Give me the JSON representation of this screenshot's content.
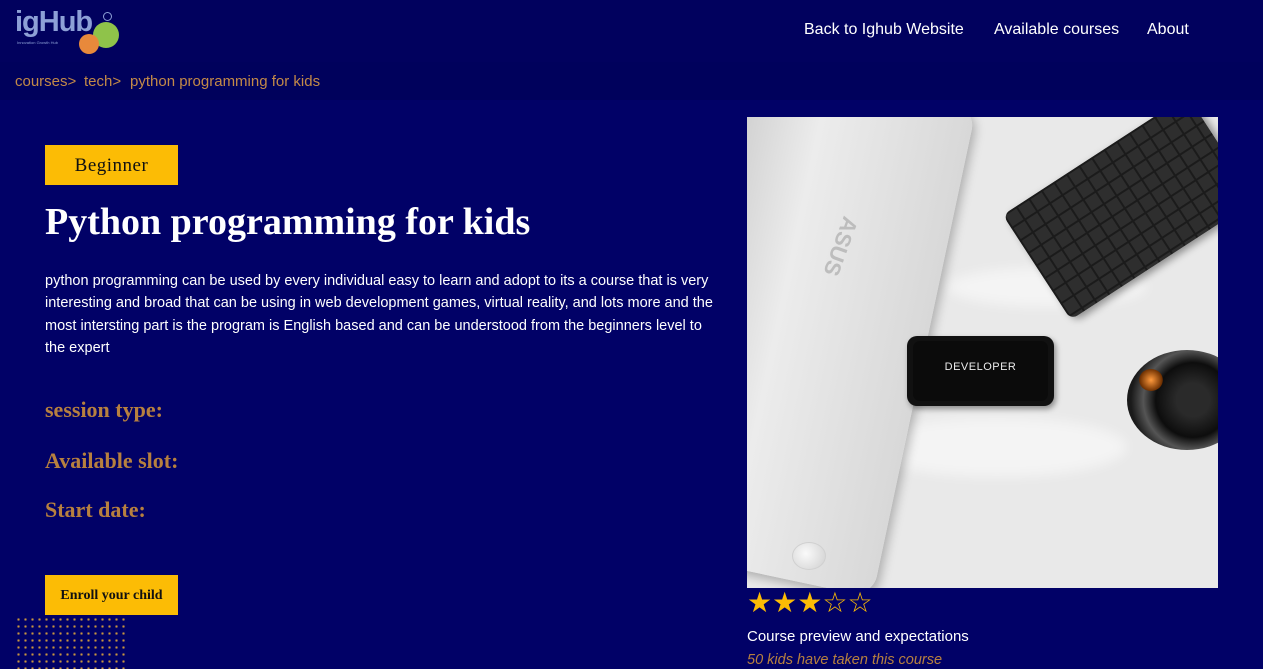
{
  "brand": {
    "logo_text": "igHub",
    "logo_tagline": "Innovation Growth Hub",
    "registered_mark": "®"
  },
  "nav": {
    "links": [
      {
        "label": "Back to Ighub Website"
      },
      {
        "label": "Available courses"
      },
      {
        "label": "About"
      }
    ]
  },
  "breadcrumb": {
    "items": [
      "courses>",
      "tech>",
      "python programming for kids"
    ]
  },
  "course": {
    "level": "Beginner",
    "title": "Python programming for kids",
    "description": "python programming can be used by every individual easy to learn and adopt to its a course that is very interesting and broad that can be using in web development games, virtual reality, and lots more and the most intersting part is the program is English based and can be understood from the beginners level to the expert",
    "session_type_label": "session type:",
    "available_slot_label": "Available slot:",
    "start_date_label": "Start date:",
    "enroll_label": "Enroll your child"
  },
  "image": {
    "phone_text": "DEVELOPER",
    "laptop_logo": "ASUS"
  },
  "rating": {
    "value": 3,
    "max": 5,
    "filled_char": "★",
    "empty_char": "☆"
  },
  "preview": {
    "title": "Course preview and expectations",
    "kids_count": "50 kids have taken this course"
  },
  "colors": {
    "background": "#010167",
    "accent": "#fcbc05",
    "muted_label": "#b7803f",
    "breadcrumb": "#c38a48"
  }
}
